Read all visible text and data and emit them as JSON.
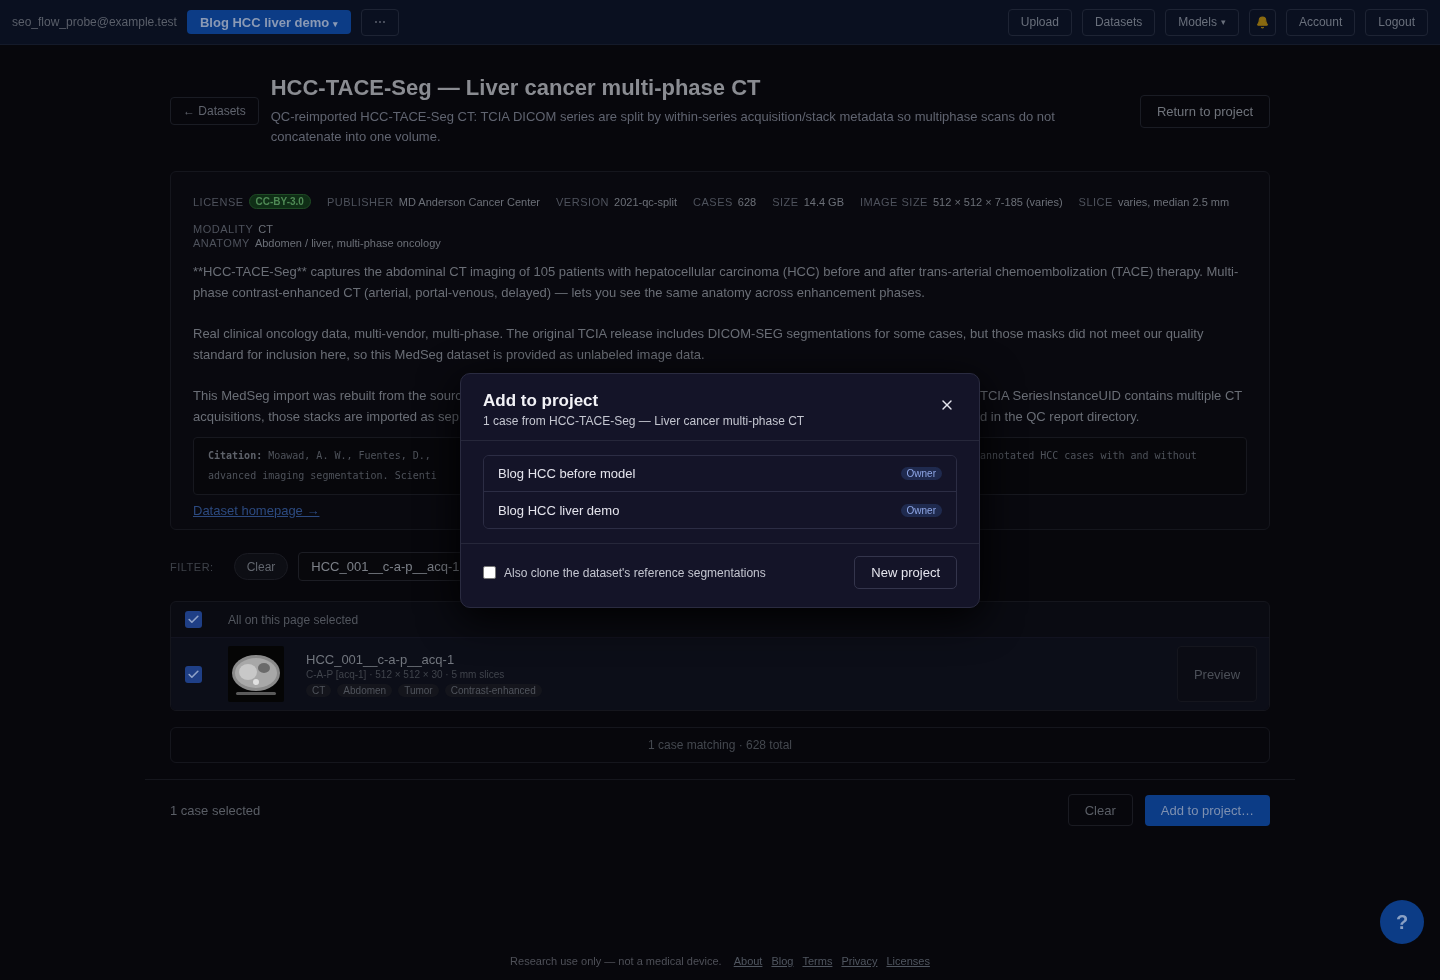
{
  "topbar": {
    "user": "seo_flow_probe@example.test",
    "project": {
      "label": "Blog HCC liver demo",
      "caret": "▾"
    },
    "more": "⋯",
    "nav": [
      {
        "kind": "button",
        "label": "Upload"
      },
      {
        "kind": "button",
        "label": "Datasets"
      },
      {
        "kind": "menu",
        "label": "Models",
        "caret": "▾"
      },
      {
        "kind": "bell"
      },
      {
        "kind": "button",
        "label": "Account"
      },
      {
        "kind": "button",
        "label": "Logout"
      }
    ]
  },
  "header": {
    "back": "← Datasets",
    "title": "HCC-TACE-Seg — Liver cancer multi-phase CT",
    "subtitle": "QC-reimported HCC-TACE-Seg CT: TCIA DICOM series are split by within-series acquisition/stack metadata so multiphase scans do not concatenate into one volume.",
    "return_button": "Return to project"
  },
  "meta": {
    "rows": [
      [
        {
          "label": "LICENSE",
          "value": "CC-BY-3.0",
          "kind": "badge"
        },
        {
          "label": "PUBLISHER",
          "value": "MD Anderson Cancer Center",
          "kind": "text"
        },
        {
          "label": "VERSION",
          "value": "2021-qc-split",
          "kind": "text"
        },
        {
          "label": "CASES",
          "value": "628",
          "kind": "text"
        },
        {
          "label": "SIZE",
          "value": "14.4 GB",
          "kind": "text"
        },
        {
          "label": "IMAGE SIZE",
          "value": "512 × 512 × 7-185 (varies)",
          "kind": "text"
        },
        {
          "label": "SLICE",
          "value": "varies, median 2.5 mm",
          "kind": "text"
        }
      ],
      [
        {
          "label": "MODALITY",
          "value": "CT",
          "kind": "text"
        }
      ],
      [
        {
          "label": "ANATOMY",
          "value": "Abdomen / liver, multi-phase oncology",
          "kind": "text"
        }
      ]
    ],
    "paragraphs": [
      "**HCC-TACE-Seg** captures the abdominal CT imaging of 105 patients with hepatocellular carcinoma (HCC) before and after trans-arterial chemoembolization (TACE) therapy. Multi-phase contrast-enhanced CT (arterial, portal-venous, delayed) — lets you see the same anatomy across enhancement phases.",
      "Real clinical oncology data, multi-vendor, multi-phase. The original TCIA release includes DICOM-SEG segmentations for some cases, but those masks did not meet our quality standard for inclusion here, so this MedSeg dataset is provided as unlabeled image data."
    ],
    "covered_paragraph": [
      {
        "left": "This MedSeg import was rebuilt from the sourc",
        "right": "TCIA SeriesInstanceUID contains multiple CT"
      },
      {
        "left": "acquisitions, those stacks are imported as sep",
        "right": "d in the QC report directory."
      }
    ],
    "citation": [
      {
        "left": "**Citation:** Moawad, A. W., Fuentes, D.,",
        "right": "annotated HCC cases with and without"
      },
      {
        "left": "advanced imaging segmentation. Scienti"
      }
    ],
    "homepage_link": "Dataset homepage →"
  },
  "filter": {
    "label": "FILTER:",
    "clear": "Clear",
    "value": "HCC_001__c-a-p__acq-1"
  },
  "table": {
    "select_all": {
      "label": "All on this page selected",
      "checked": true
    },
    "rows": [
      {
        "name": "HCC_001__c-a-p__acq-1",
        "details": "C-A-P [acq-1] · 512 × 512 × 30 · 5 mm slices",
        "tags": [
          "CT",
          "Abdomen",
          "Tumor",
          "Contrast-enhanced"
        ],
        "checked": true,
        "preview": "Preview"
      }
    ]
  },
  "summary": "1 case matching · 628 total",
  "selection_bar": {
    "count": "1 case selected",
    "clear": "Clear",
    "add": "Add to project…"
  },
  "footer": {
    "note": "Research use only — not a medical device.",
    "links": [
      "About",
      "Blog",
      "Terms",
      "Privacy",
      "Licenses"
    ]
  },
  "help": "?",
  "modal": {
    "title": "Add to project",
    "subtitle": "1 case from HCC-TACE-Seg — Liver cancer multi-phase CT",
    "projects": [
      {
        "name": "Blog HCC before model",
        "role": "Owner"
      },
      {
        "name": "Blog HCC liver demo",
        "role": "Owner"
      }
    ],
    "clone": {
      "label": "Also clone the dataset's reference segmentations",
      "checked": false
    },
    "new_project": "New project"
  }
}
